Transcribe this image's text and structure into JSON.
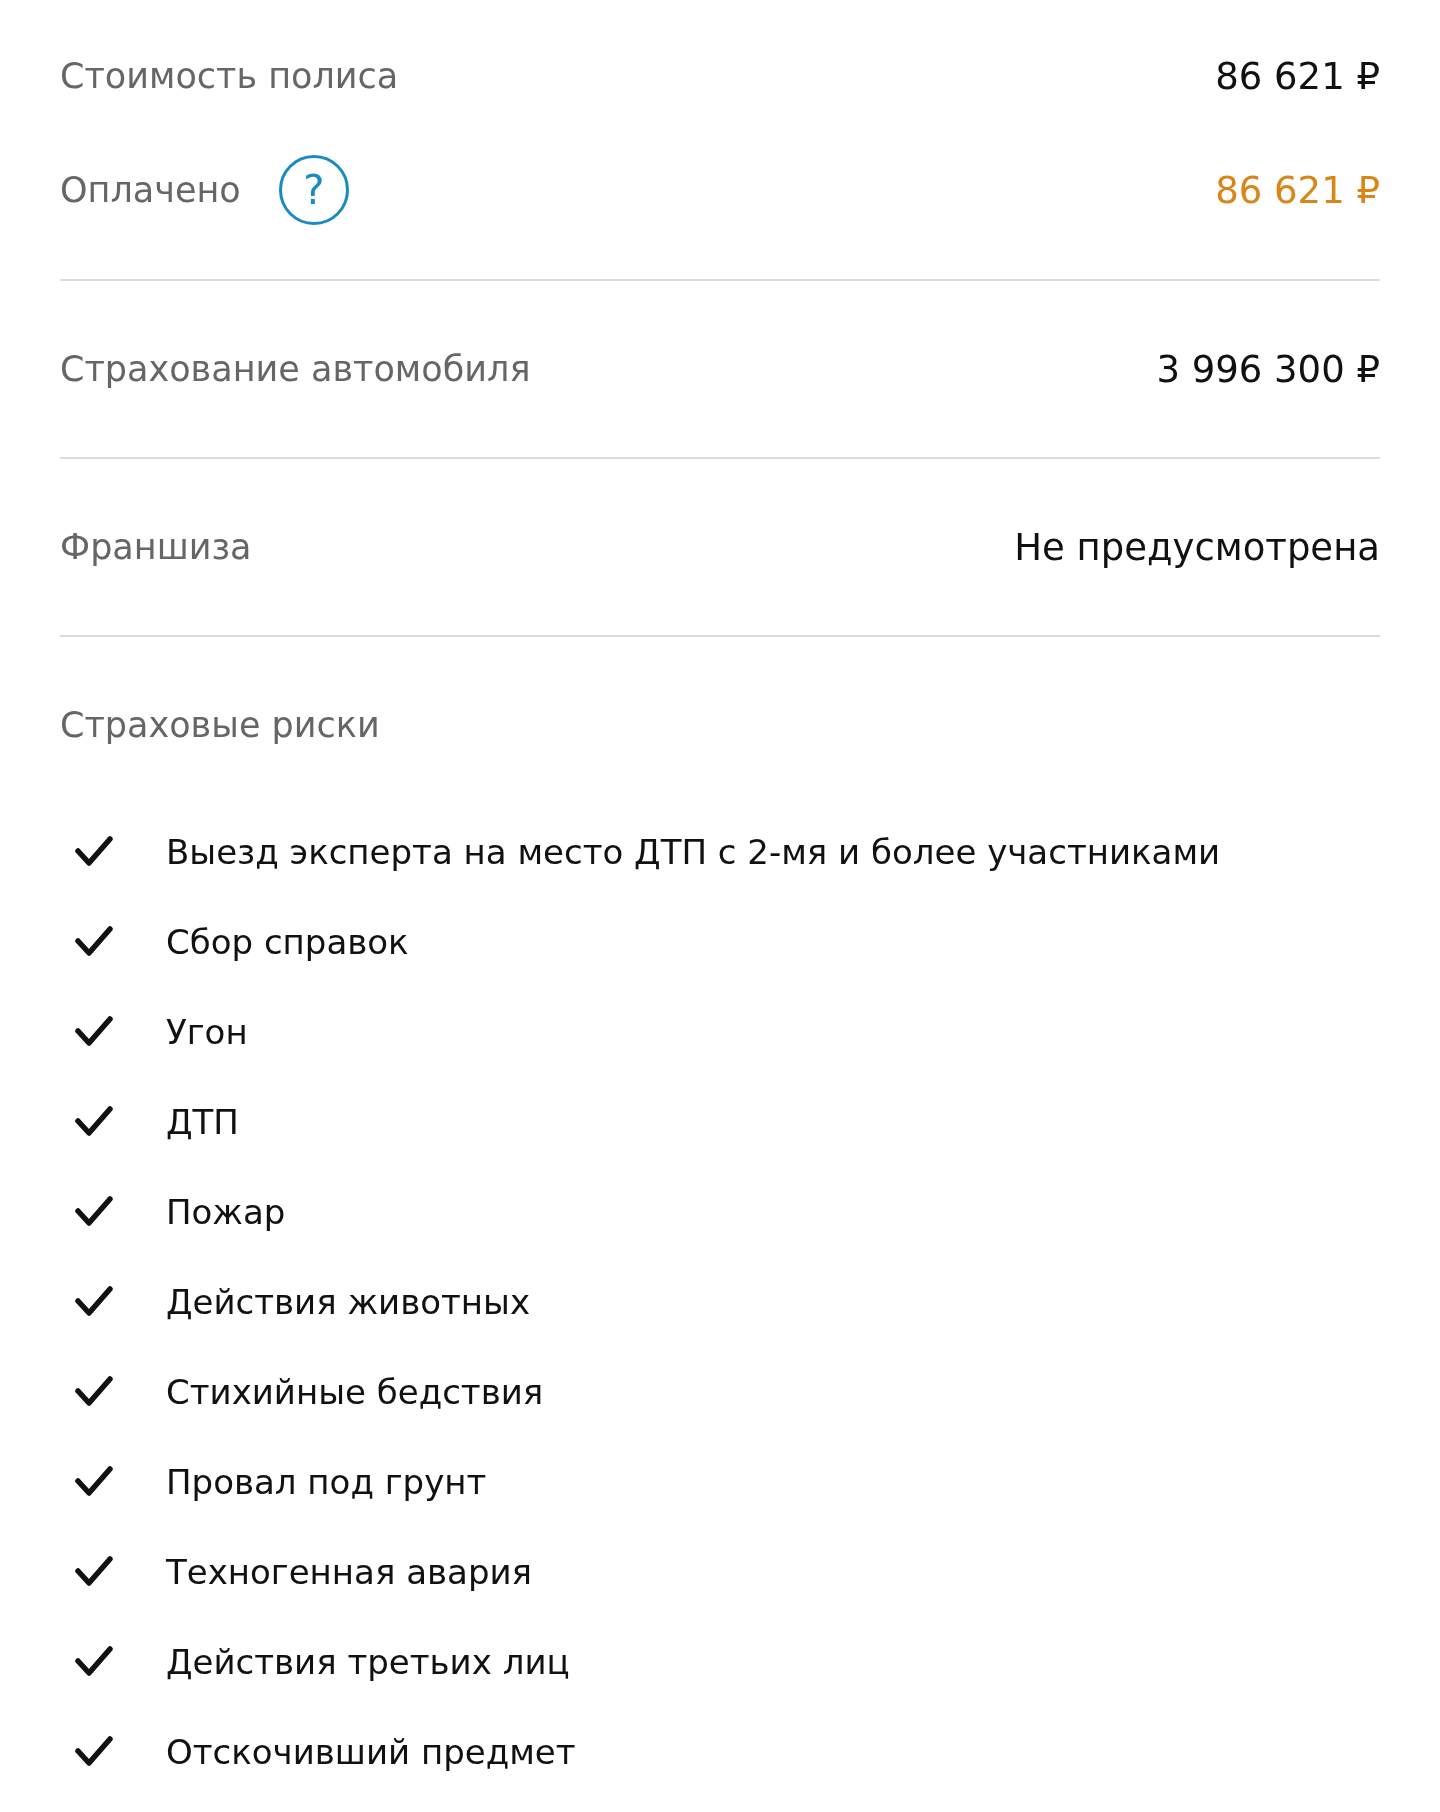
{
  "summary": [
    {
      "label": "Стоимость полиса",
      "value": "86 621 ₽",
      "kind": "plain"
    },
    {
      "label": "Оплачено",
      "value": "86 621 ₽",
      "kind": "paid",
      "help": "?"
    }
  ],
  "details": [
    {
      "label": "Страхование автомобиля",
      "value": "3 996 300 ₽"
    },
    {
      "label": "Франшиза",
      "value": "Не предусмотрена"
    }
  ],
  "risks_title": "Страховые риски",
  "risks": [
    {
      "label": "Выезд эксперта на место ДТП с 2-мя и более участниками",
      "checked": true
    },
    {
      "label": "Сбор справок",
      "checked": true
    },
    {
      "label": "Угон",
      "checked": true
    },
    {
      "label": "ДТП",
      "checked": true
    },
    {
      "label": "Пожар",
      "checked": true
    },
    {
      "label": "Действия животных",
      "checked": true
    },
    {
      "label": "Стихийные бедствия",
      "checked": true
    },
    {
      "label": "Провал под грунт",
      "checked": true
    },
    {
      "label": "Техногенная авария",
      "checked": true
    },
    {
      "label": "Действия третьих лиц",
      "checked": true
    },
    {
      "label": "Отскочивший предмет",
      "checked": true
    }
  ]
}
